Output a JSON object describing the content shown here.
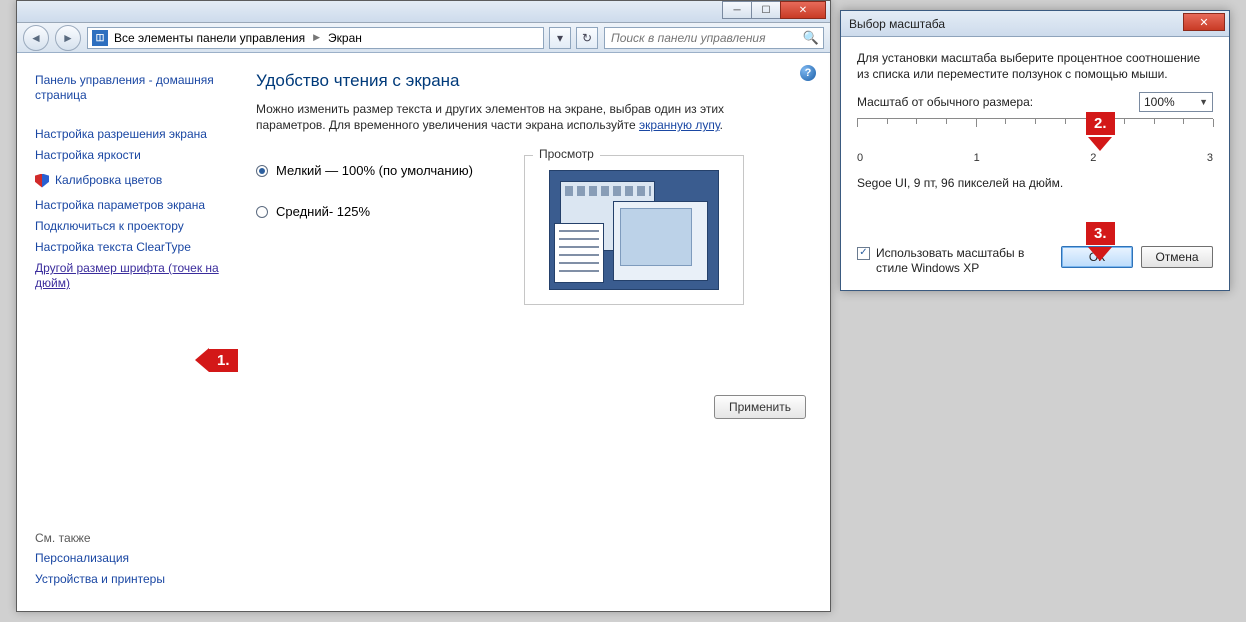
{
  "main_window": {
    "breadcrumb": {
      "root": "Все элементы панели управления",
      "leaf": "Экран"
    },
    "search_placeholder": "Поиск в панели управления",
    "sidebar": {
      "items": [
        "Панель управления - домашняя страница",
        "Настройка разрешения экрана",
        "Настройка яркости",
        "Калибровка цветов",
        "Настройка параметров экрана",
        "Подключиться к проектору",
        "Настройка текста ClearType",
        "Другой размер шрифта (точек на дюйм)"
      ],
      "see_also_title": "См. также",
      "see_also": [
        "Персонализация",
        "Устройства и принтеры"
      ]
    },
    "content": {
      "title": "Удобство чтения с экрана",
      "desc_before_link": "Можно изменить размер текста и других элементов на экране, выбрав один из этих параметров. Для временного увеличения части экрана используйте ",
      "desc_link": "экранную лупу",
      "desc_after_link": ".",
      "radio_small": "Мелкий — 100% (по умолчанию)",
      "radio_medium": "Средний- 125%",
      "preview_legend": "Просмотр",
      "apply": "Применить"
    }
  },
  "markers": {
    "m1": "1.",
    "m2": "2.",
    "m3": "3."
  },
  "dialog": {
    "title": "Выбор масштаба",
    "intro": "Для установки масштаба выберите процентное соотношение из списка или переместите ползунок с помощью мыши.",
    "scale_label": "Масштаб от обычного размера:",
    "scale_value": "100%",
    "ruler_labels": [
      "0",
      "1",
      "2",
      "3"
    ],
    "sample_text": "Segoe UI, 9 пт, 96 пикселей на дюйм.",
    "xp_checkbox": "Использовать масштабы в стиле Windows XP",
    "ok": "ОК",
    "cancel": "Отмена"
  }
}
